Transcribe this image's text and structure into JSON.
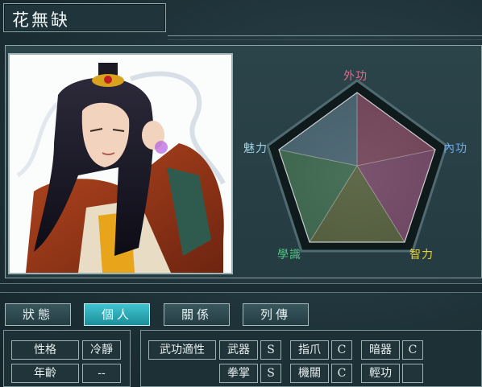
{
  "character": {
    "name": "花無缺"
  },
  "radar": {
    "labels": {
      "top": "外功",
      "right": "內功",
      "bottom_right": "智力",
      "bottom_left": "學識",
      "left": "魅力"
    },
    "label_colors": {
      "top": "#e06a8a",
      "right": "#6ea9e8",
      "bottom_right": "#e8d23a",
      "bottom_left": "#4ec080",
      "left": "#9fd2e6"
    },
    "values": {
      "top": 1.0,
      "right": 1.0,
      "bottom_right": 1.0,
      "bottom_left": 1.0,
      "left": 1.0
    }
  },
  "tabs": [
    {
      "label": "狀態",
      "active": false
    },
    {
      "label": "個人",
      "active": true
    },
    {
      "label": "關係",
      "active": false
    },
    {
      "label": "列傳",
      "active": false
    }
  ],
  "profile": {
    "personality_label": "性格",
    "personality_value": "冷靜",
    "age_label": "年齡",
    "age_value": "--"
  },
  "martial": {
    "header": "武功適性",
    "skills": [
      {
        "name": "武器",
        "grade": "S"
      },
      {
        "name": "指爪",
        "grade": "C"
      },
      {
        "name": "暗器",
        "grade": "C"
      },
      {
        "name": "拳掌",
        "grade": "S"
      },
      {
        "name": "機關",
        "grade": "C"
      },
      {
        "name": "輕功",
        "grade": ""
      }
    ]
  }
}
